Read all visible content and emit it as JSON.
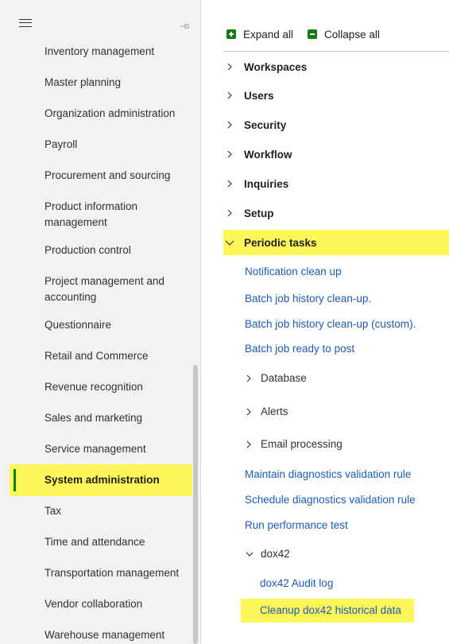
{
  "nav": {
    "items": [
      {
        "label": "Inventory management"
      },
      {
        "label": "Master planning"
      },
      {
        "label": "Organization administration"
      },
      {
        "label": "Payroll"
      },
      {
        "label": "Procurement and sourcing"
      },
      {
        "label": "Product information management"
      },
      {
        "label": "Production control"
      },
      {
        "label": "Project management and accounting"
      },
      {
        "label": "Questionnaire"
      },
      {
        "label": "Retail and Commerce"
      },
      {
        "label": "Revenue recognition"
      },
      {
        "label": "Sales and marketing"
      },
      {
        "label": "Service management"
      },
      {
        "label": "System administration"
      },
      {
        "label": "Tax"
      },
      {
        "label": "Time and attendance"
      },
      {
        "label": "Transportation management"
      },
      {
        "label": "Vendor collaboration"
      },
      {
        "label": "Warehouse management"
      }
    ],
    "selected": "System administration",
    "colors": {
      "highlight": "#fdf75c",
      "selected_bar": "#107c10"
    }
  },
  "toolbar": {
    "expand_label": "Expand all",
    "collapse_label": "Collapse all"
  },
  "groups": {
    "workspaces": "Workspaces",
    "users": "Users",
    "security": "Security",
    "workflow": "Workflow",
    "inquiries": "Inquiries",
    "setup": "Setup",
    "periodic": "Periodic tasks"
  },
  "periodic": {
    "notification_cleanup": "Notification clean up",
    "batch_history_cleanup": "Batch job history clean-up.",
    "batch_history_cleanup_custom": "Batch job history clean-up (custom).",
    "batch_ready_to_post": "Batch job ready to post",
    "database": "Database",
    "alerts": "Alerts",
    "email_processing": "Email processing",
    "maintain_diag_rule": "Maintain diagnostics validation rule",
    "schedule_diag_rule": "Schedule diagnostics validation rule",
    "run_perf_test": "Run performance test",
    "dox42": "dox42",
    "dox42_audit_log": "dox42 Audit log",
    "cleanup_dox42": "Cleanup dox42 historical data"
  },
  "icons": {
    "menu": "hamburger-icon",
    "pin": "pin-icon",
    "expand": "expand-all-icon",
    "collapse": "collapse-all-icon",
    "chevron_right": "chevron-right-icon",
    "chevron_down": "chevron-down-icon"
  }
}
